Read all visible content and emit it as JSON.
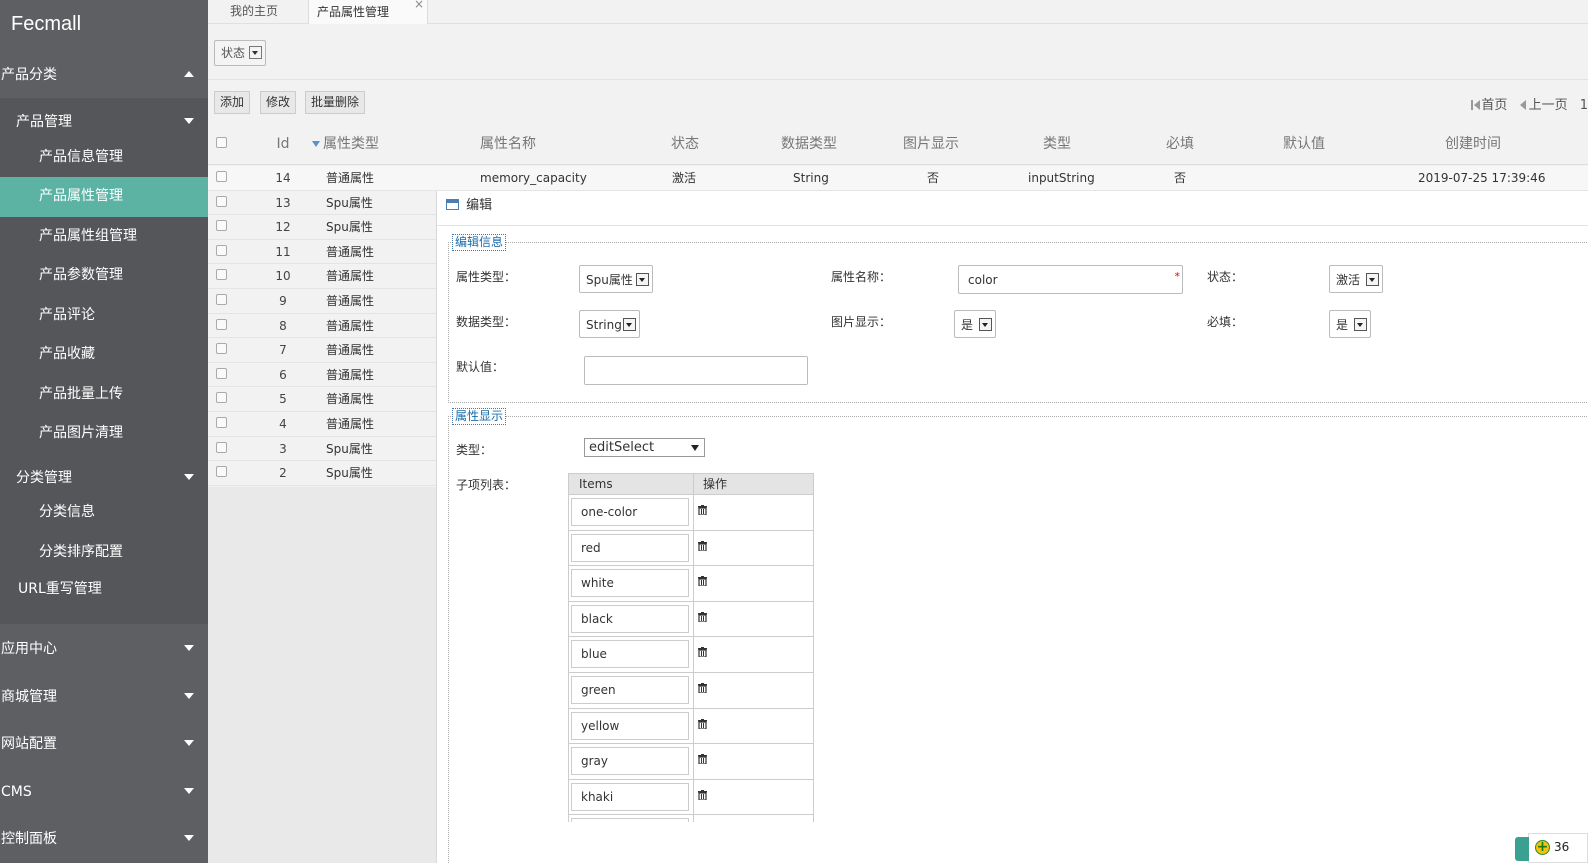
{
  "app": {
    "logo": "Fecmall"
  },
  "sidebar": {
    "groups_top": [
      {
        "label": "产品分类"
      }
    ],
    "product_mgmt": {
      "label": "产品管理",
      "items": [
        {
          "label": "产品信息管理"
        },
        {
          "label": "产品属性管理"
        },
        {
          "label": "产品属性组管理"
        },
        {
          "label": "产品参数管理"
        },
        {
          "label": "产品评论"
        },
        {
          "label": "产品收藏"
        },
        {
          "label": "产品批量上传"
        },
        {
          "label": "产品图片清理"
        }
      ]
    },
    "category_mgmt": {
      "label": "分类管理",
      "items": [
        {
          "label": "分类信息"
        },
        {
          "label": "分类排序配置"
        }
      ]
    },
    "url_rewrite": "URL重写管理",
    "groups_bottom": [
      {
        "label": "应用中心"
      },
      {
        "label": "商城管理"
      },
      {
        "label": "网站配置"
      },
      {
        "label": "CMS"
      },
      {
        "label": "控制面板"
      }
    ],
    "active_item": "产品属性管理"
  },
  "tabs": [
    {
      "label": "我的主页"
    },
    {
      "label": "产品属性管理",
      "close": "×"
    }
  ],
  "filter": {
    "status_label": "状态"
  },
  "toolbar": {
    "add": "添加",
    "edit": "修改",
    "batch_delete": "批量删除",
    "pager": {
      "first": "首页",
      "prev": "上一页",
      "page": "1"
    }
  },
  "table": {
    "columns": [
      "Id",
      "属性类型",
      "属性名称",
      "状态",
      "数据类型",
      "图片显示",
      "类型",
      "必填",
      "默认值",
      "创建时间"
    ],
    "first_row": {
      "id": "14",
      "attr_type": "普通属性",
      "name": "memory_capacity",
      "status": "激活",
      "data_type": "String",
      "image_show": "否",
      "type": "inputString",
      "required": "否",
      "default": "",
      "created": "2019-07-25 17:39:46"
    },
    "rows": [
      {
        "id": "13",
        "attr_type": "Spu属性"
      },
      {
        "id": "12",
        "attr_type": "Spu属性"
      },
      {
        "id": "11",
        "attr_type": "普通属性"
      },
      {
        "id": "10",
        "attr_type": "普通属性"
      },
      {
        "id": "9",
        "attr_type": "普通属性"
      },
      {
        "id": "8",
        "attr_type": "普通属性"
      },
      {
        "id": "7",
        "attr_type": "普通属性"
      },
      {
        "id": "6",
        "attr_type": "普通属性"
      },
      {
        "id": "5",
        "attr_type": "普通属性"
      },
      {
        "id": "4",
        "attr_type": "普通属性"
      },
      {
        "id": "3",
        "attr_type": "Spu属性"
      },
      {
        "id": "2",
        "attr_type": "Spu属性"
      }
    ]
  },
  "dialog": {
    "title": "编辑",
    "section_info": "编辑信息",
    "fields": {
      "attr_type_label": "属性类型：",
      "attr_type_value": "Spu属性",
      "attr_name_label": "属性名称：",
      "attr_name_value": "color",
      "attr_name_required": "*",
      "status_label": "状态：",
      "status_value": "激活",
      "data_type_label": "数据类型：",
      "data_type_value": "String",
      "image_show_label": "图片显示：",
      "image_show_value": "是",
      "required_label": "必填：",
      "required_value": "是",
      "default_label": "默认值：",
      "default_value": ""
    },
    "section_display": "属性显示",
    "display": {
      "type_label": "类型：",
      "type_value": "editSelect",
      "items_label": "子项列表：",
      "items_header": {
        "items": "Items",
        "action": "操作"
      },
      "items": [
        "one-color",
        "red",
        "white",
        "black",
        "blue",
        "green",
        "yellow",
        "gray",
        "khaki",
        ""
      ]
    }
  },
  "badge": {
    "count": "36"
  },
  "colors": {
    "sidebar_bg": "#5d5f63",
    "active_item": "#5cb3a4",
    "legend_text": "#1a6da9"
  }
}
